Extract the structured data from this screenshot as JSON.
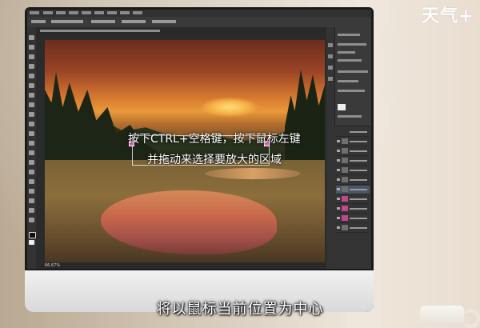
{
  "watermark": {
    "logo_text": "天气+"
  },
  "photoshop": {
    "status": {
      "zoom_text": "66.67%"
    },
    "canvas_overlay": {
      "line1": "按下CTRL+空格键，按下鼠标左键",
      "line2": "并拖动来选择要放大的区域"
    }
  },
  "caption": {
    "subtitle": "将以鼠标当前位置为中心"
  },
  "colors": {
    "handle": "#ff5bd8",
    "ui_dark": "#2b2b2b",
    "selected_layer": "#4b5666"
  },
  "icons": [
    "move-tool-icon",
    "marquee-tool-icon",
    "lasso-tool-icon",
    "crop-tool-icon",
    "brush-tool-icon",
    "eraser-tool-icon",
    "text-tool-icon",
    "zoom-tool-icon",
    "eye-icon"
  ]
}
